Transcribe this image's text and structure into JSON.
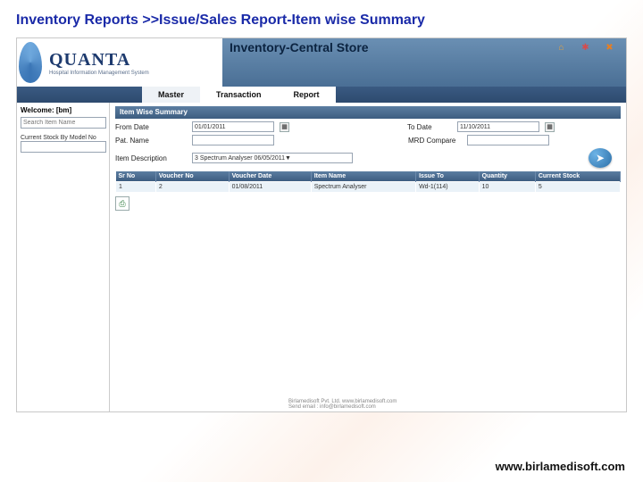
{
  "slide": {
    "title": "Inventory Reports >>Issue/Sales Report-Item wise Summary",
    "footer": "www.birlamedisoft.com"
  },
  "logo": {
    "brand": "QUANTA",
    "tagline": "Hospital Information Management System"
  },
  "app_title": "Inventory-Central Store",
  "top_icons": [
    "home-icon",
    "help-icon",
    "close-icon"
  ],
  "menu": {
    "master": "Master",
    "transaction": "Transaction",
    "report": "Report"
  },
  "left": {
    "welcome_label": "Welcome: [bm]",
    "search_placeholder": "Search Item Name",
    "current_stock_label": "Current Stock By Model No",
    "modelno_value": ""
  },
  "panel": {
    "title": "Item Wise Summary",
    "from_date_label": "From Date",
    "from_date_value": "01/01/2011",
    "to_date_label": "To Date",
    "to_date_value": "11/10/2011",
    "patient_name_label": "Pat. Name",
    "patient_name_value": "",
    "mr_compare_label": "MRD Compare",
    "mr_compare_value": "",
    "item_desc_label": "Item Description",
    "item_desc_select": "3    Spectrum Analyser    06/05/2011▼"
  },
  "table": {
    "headers": {
      "srno": "Sr No",
      "voucher_no": "Voucher No",
      "voucher_date": "Voucher Date",
      "item_name": "Item Name",
      "issue_to": "Issue To",
      "quantity": "Quantity",
      "current_stock": "Current Stock"
    },
    "row": {
      "srno": "1",
      "voucher_no": "2",
      "voucher_date": "01/08/2011",
      "item_name": "Spectrum Analyser",
      "issue_to": "Wd-1(114)",
      "quantity": "10",
      "current_stock": "5"
    }
  },
  "footer_info": {
    "line1": "Birlamedisoft Pvt. Ltd. www.birlamedisoft.com",
    "line2": "Send email : info@birlamedisoft.com"
  }
}
